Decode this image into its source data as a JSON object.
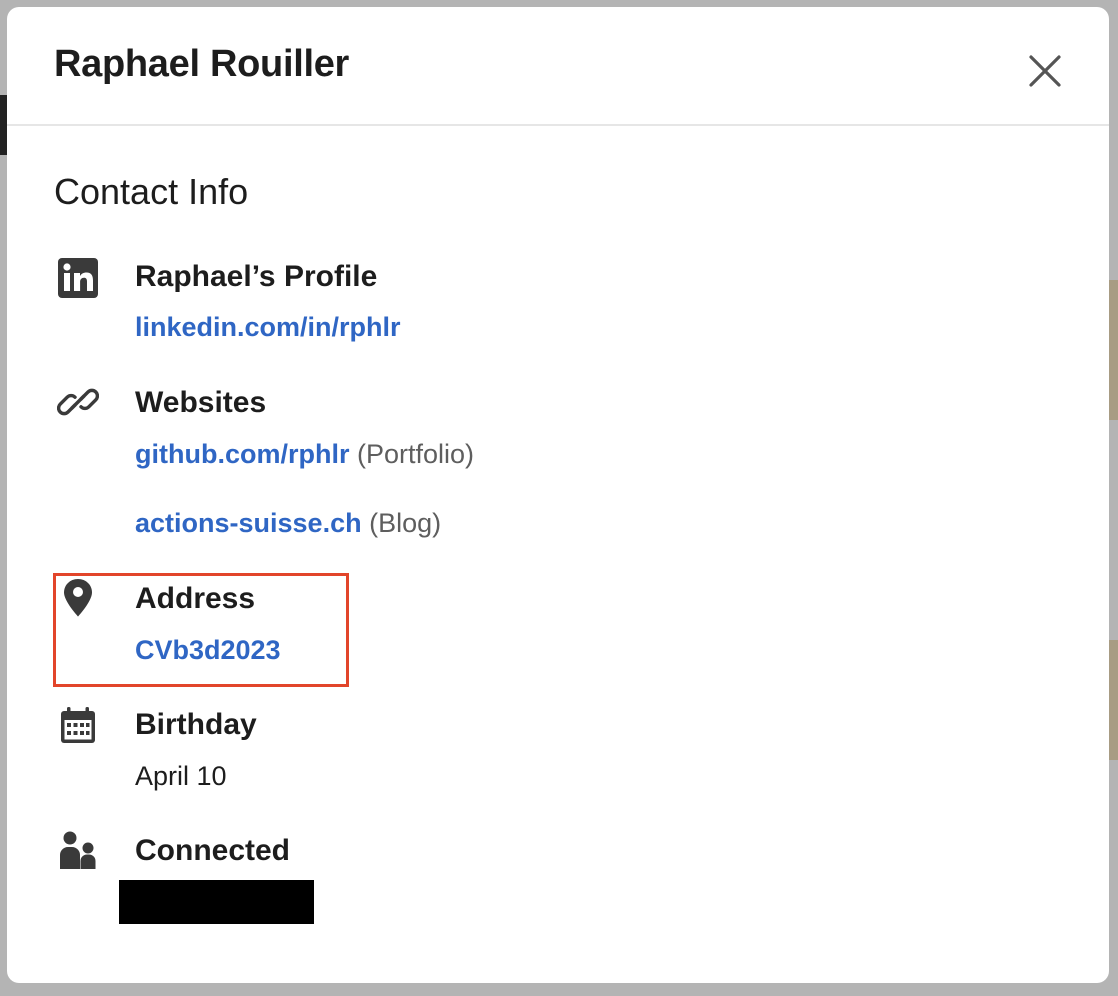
{
  "modal": {
    "title": "Raphael Rouiller",
    "close_icon": "close-icon"
  },
  "contact": {
    "section_title": "Contact Info",
    "profile": {
      "icon": "linkedin-icon",
      "heading": "Raphael’s Profile",
      "url": "linkedin.com/in/rphlr"
    },
    "websites": {
      "icon": "link-icon",
      "heading": "Websites",
      "items": [
        {
          "url": "github.com/rphlr",
          "note": "(Portfolio)"
        },
        {
          "url": "actions-suisse.ch",
          "note": "(Blog)"
        }
      ]
    },
    "address": {
      "icon": "location-pin-icon",
      "heading": "Address",
      "value": "CVb3d2023"
    },
    "birthday": {
      "icon": "calendar-icon",
      "heading": "Birthday",
      "value": "April 10"
    },
    "connected": {
      "icon": "people-icon",
      "heading": "Connected"
    }
  },
  "colors": {
    "link": "#2f66c4",
    "highlight": "#e2452a",
    "text": "#1d1d1d"
  }
}
